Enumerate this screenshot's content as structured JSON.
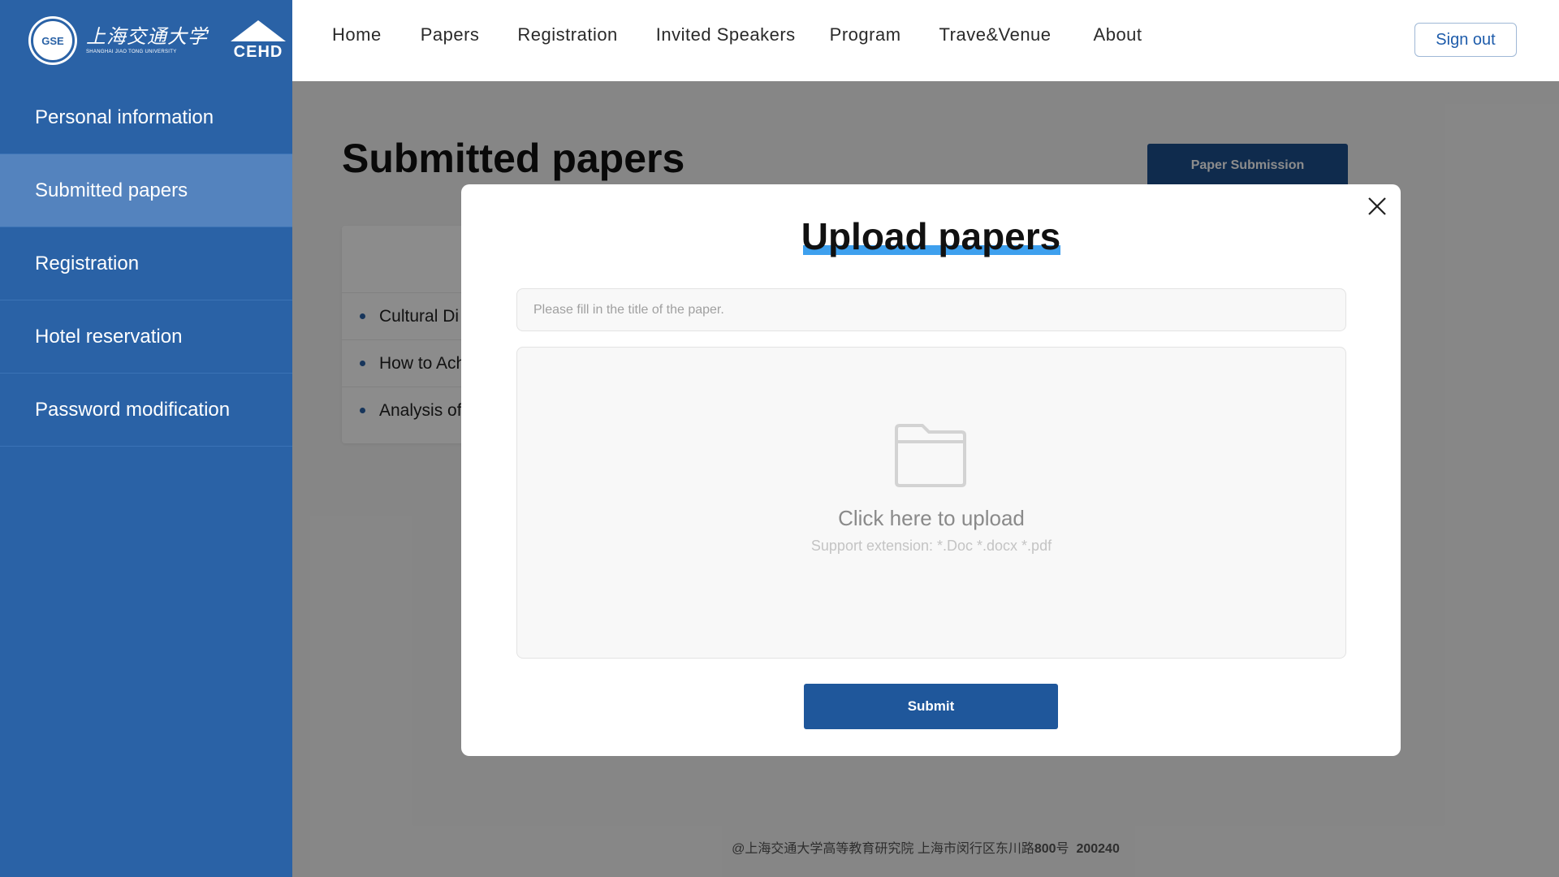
{
  "brand": {
    "seal_text": "GSE",
    "university_cn": "上海交通大学",
    "university_en": "SHANGHAI JIAO TONG UNIVERSITY",
    "cehd_text": "CEHD"
  },
  "nav": {
    "items": [
      "Home",
      "Papers",
      "Registration",
      "Invited Speakers",
      "Program",
      "Trave&Venue",
      "About"
    ],
    "sign_out": "Sign out"
  },
  "sidebar": {
    "items": [
      {
        "label": "Personal information"
      },
      {
        "label": "Submitted papers",
        "active": true
      },
      {
        "label": "Registration"
      },
      {
        "label": "Hotel reservation"
      },
      {
        "label": "Password modification"
      }
    ]
  },
  "main": {
    "title": "Submitted papers",
    "submit_button": "Paper Submission",
    "papers": [
      "Cultural Di",
      "How to Ach",
      "Analysis of"
    ]
  },
  "footer": {
    "text": "@上海交通大学高等教育研究院   上海市闵行区东川路",
    "num1": "800",
    "hao": "号",
    "postcode": "200240"
  },
  "modal": {
    "title": "Upload papers",
    "title_placeholder": "Please fill in the title of the paper.",
    "upload_label": "Click here to upload",
    "upload_hint": "Support extension: *.Doc  *.docx  *.pdf",
    "submit": "Submit"
  },
  "colors": {
    "primary": "#2a62a6",
    "accent": "#3ea0ee",
    "button_dark": "#1f579b"
  }
}
